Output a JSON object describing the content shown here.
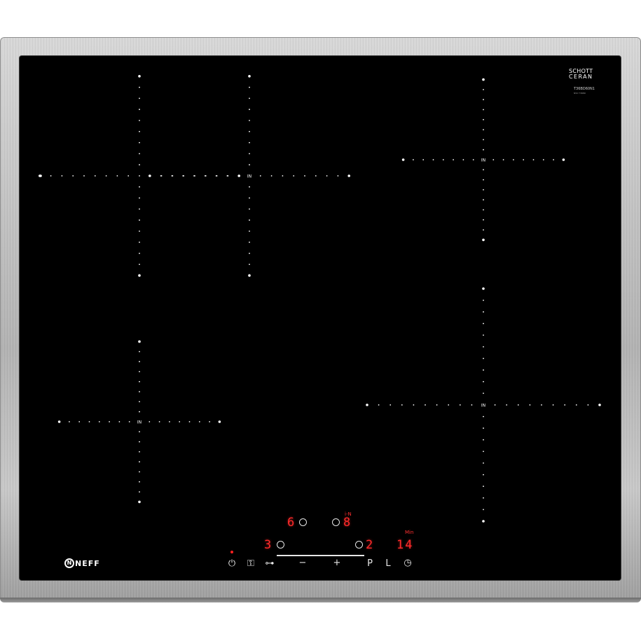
{
  "appliance": {
    "brand_logo_text": "NEFF",
    "glass_brand_line1": "SCHOTT",
    "glass_brand_line2": "CERAN",
    "model_code": "T36BD60N1",
    "model_code_sub": "N50 T36BD",
    "zone_label": "IN",
    "colors": {
      "glass": "#000000",
      "frame": "#c4c4c4",
      "dots": "#ffffff",
      "display": "#ff2a2a"
    }
  },
  "displays": {
    "zone_front_left_level": "3",
    "zone_rear_left_level": "6",
    "zone_rear_right_level": "8",
    "zone_front_right_level": "2",
    "timer_value": "14",
    "timer_unit": "Min",
    "rear_right_indicator": "i-N"
  },
  "controls": {
    "power": "⏻",
    "child_lock": "⚿",
    "wipe_protect": "⊶",
    "minus": "−",
    "plus": "+",
    "powerboost": "P",
    "lock": "L",
    "timer": "◷"
  },
  "icons": {
    "power": "power-icon",
    "child_lock": "child-lock-icon",
    "wipe_protect": "key-icon",
    "timer": "clock-icon"
  }
}
